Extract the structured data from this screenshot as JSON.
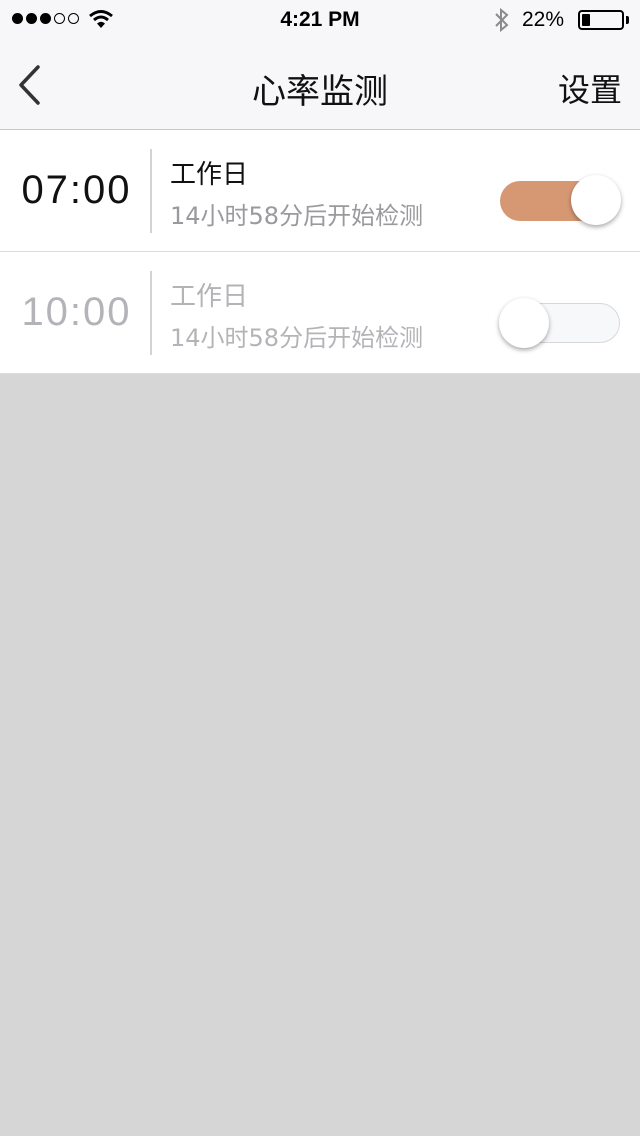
{
  "status_bar": {
    "signal_bars_filled": 3,
    "signal_bars_total": 5,
    "wifi_icon": "wifi-icon",
    "time": "4:21 PM",
    "bluetooth_icon": "bluetooth-icon",
    "battery_percent": "22%",
    "battery_level": 0.22
  },
  "nav": {
    "back_icon": "chevron-left-icon",
    "title": "心率监测",
    "right_button": "设置"
  },
  "alarms": [
    {
      "time": "07:00",
      "label": "工作日",
      "subtitle": "14小时58分后开始检测",
      "enabled": true
    },
    {
      "time": "10:00",
      "label": "工作日",
      "subtitle": "14小时58分后开始检测",
      "enabled": false
    }
  ],
  "colors": {
    "accent_toggle_on": "#d69873",
    "background": "#d6d6d6",
    "navbar_bg": "#f7f7f9"
  }
}
